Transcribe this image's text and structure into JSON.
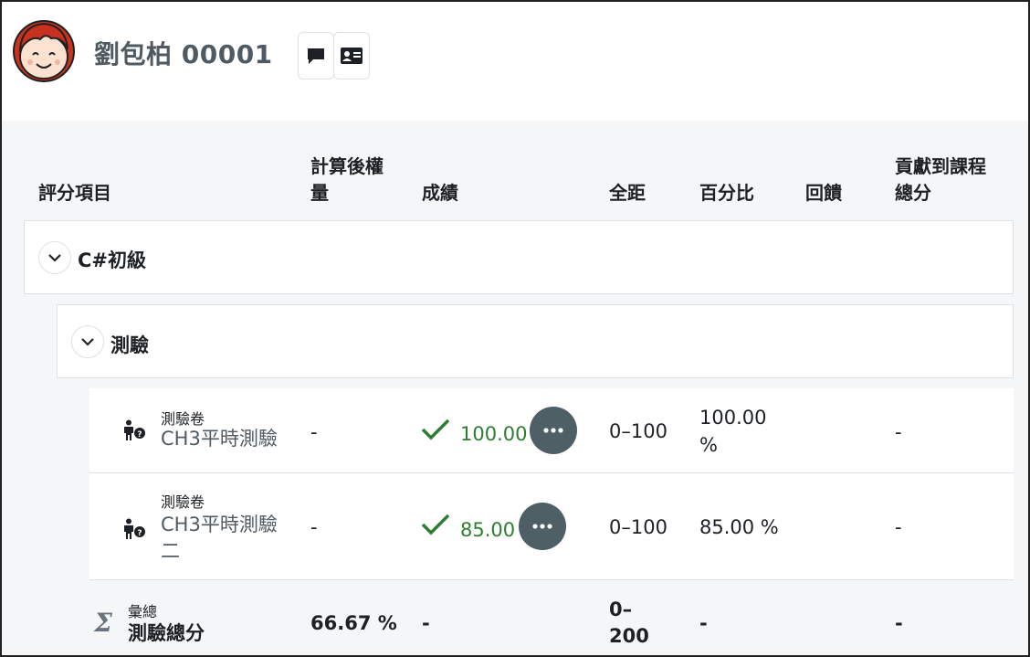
{
  "user": {
    "name": "劉包柏 00001"
  },
  "table": {
    "headers": {
      "item": "評分項目",
      "weight_l1": "計算後權",
      "weight_l2": "量",
      "grade": "成績",
      "range": "全距",
      "percent": "百分比",
      "feedback": "回饋",
      "contrib_l1": "貢獻到課程",
      "contrib_l2": "總分"
    },
    "categories": [
      {
        "name": "C#初級"
      },
      {
        "name": "測驗"
      }
    ],
    "rows": [
      {
        "type": "測驗卷",
        "name": "CH3平時測驗",
        "weight": "-",
        "grade": "100.00",
        "range": "0–100",
        "percent_l1": "100.00",
        "percent_l2": "%",
        "contribution": "-"
      },
      {
        "type": "測驗卷",
        "name_l1": "CH3平時測驗",
        "name_l2": "二",
        "weight": "-",
        "grade": "85.00",
        "range": "0–100",
        "percent": "85.00 %",
        "contribution": "-"
      }
    ],
    "total": {
      "type": "彙總",
      "name": "測驗總分",
      "weight": "66.67 %",
      "grade": "-",
      "range_l1": "0–",
      "range_l2": "200",
      "percent": "-",
      "contribution": "-"
    }
  },
  "icons": {
    "message": "message-icon",
    "profile": "id-card-icon",
    "chevron": "chevron-down-icon",
    "quiz": "quiz-person-icon",
    "check": "check-icon",
    "more": "ellipsis-icon",
    "sum": "sigma-icon"
  },
  "colors": {
    "grade_green": "#2f7d32",
    "more_button": "#4f5f66",
    "name_gray": "#4f5a62"
  }
}
